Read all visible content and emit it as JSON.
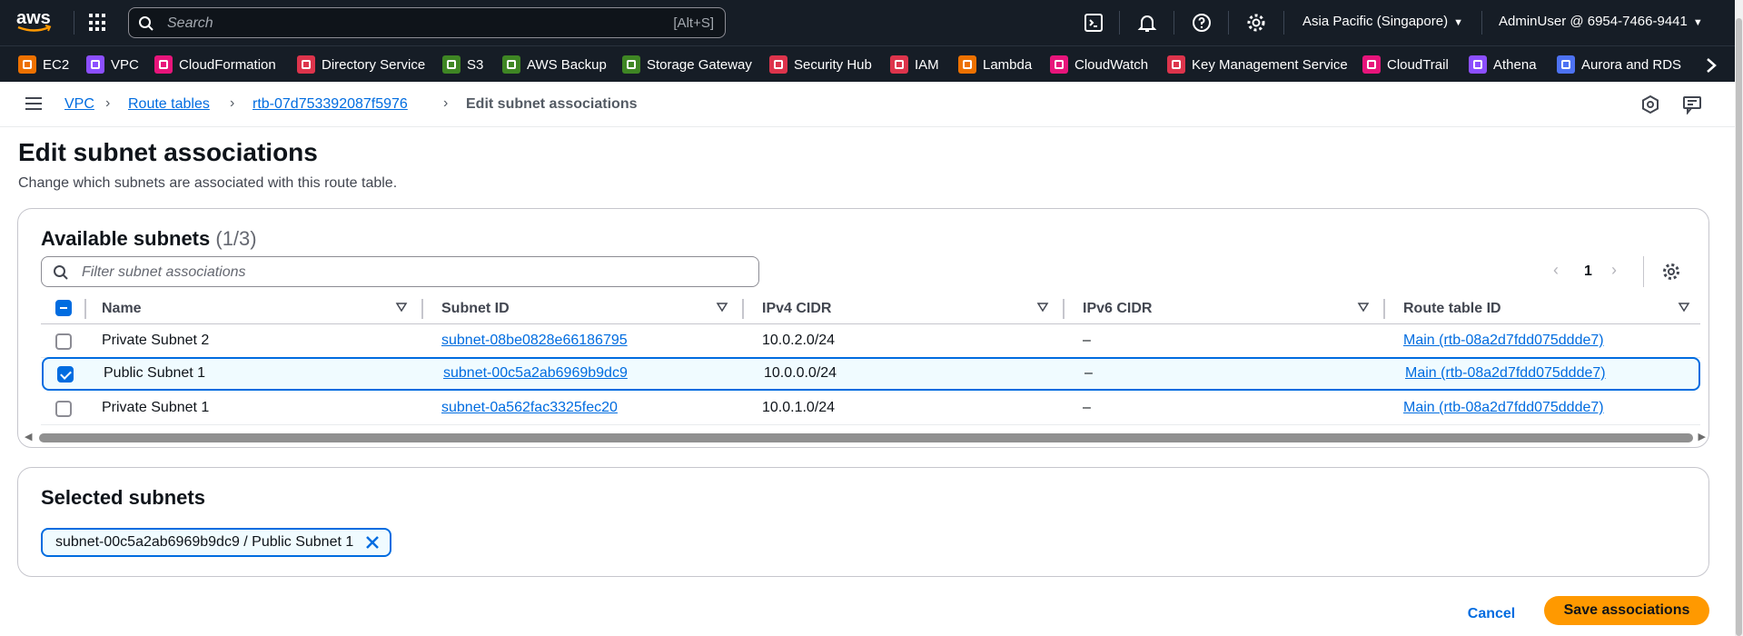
{
  "topnav": {
    "logo_text": "aws",
    "search_placeholder": "Search",
    "search_shortcut": "[Alt+S]",
    "region": "Asia Pacific (Singapore)",
    "account": "AdminUser @ 6954-7466-9441"
  },
  "favorites": [
    {
      "label": "EC2",
      "color": "#ed7100"
    },
    {
      "label": "VPC",
      "color": "#8c4fff"
    },
    {
      "label": "CloudFormation",
      "color": "#e7157b"
    },
    {
      "label": "Directory Service",
      "color": "#dd344c"
    },
    {
      "label": "S3",
      "color": "#3f8624"
    },
    {
      "label": "AWS Backup",
      "color": "#3f8624"
    },
    {
      "label": "Storage Gateway",
      "color": "#3f8624"
    },
    {
      "label": "Security Hub",
      "color": "#dd344c"
    },
    {
      "label": "IAM",
      "color": "#dd344c"
    },
    {
      "label": "Lambda",
      "color": "#ed7100"
    },
    {
      "label": "CloudWatch",
      "color": "#e7157b"
    },
    {
      "label": "Key Management Service",
      "color": "#dd344c"
    },
    {
      "label": "CloudTrail",
      "color": "#e7157b"
    },
    {
      "label": "Athena",
      "color": "#8c4fff"
    },
    {
      "label": "Aurora and RDS",
      "color": "#4d72f3"
    }
  ],
  "breadcrumb": {
    "items": [
      "VPC",
      "Route tables",
      "rtb-07d753392087f5976"
    ],
    "current": "Edit subnet associations"
  },
  "page": {
    "title": "Edit subnet associations",
    "description": "Change which subnets are associated with this route table."
  },
  "available": {
    "title": "Available subnets",
    "count": "(1/3)",
    "filter_placeholder": "Filter subnet associations",
    "page_number": "1",
    "columns": [
      "Name",
      "Subnet ID",
      "IPv4 CIDR",
      "IPv6 CIDR",
      "Route table ID"
    ],
    "rows": [
      {
        "name": "Private Subnet 2",
        "subnet_id": "subnet-08be0828e66186795",
        "ipv4": "10.0.2.0/24",
        "ipv6": "–",
        "route_table": "Main (rtb-08a2d7fdd075ddde7)",
        "selected": false
      },
      {
        "name": "Public Subnet 1",
        "subnet_id": "subnet-00c5a2ab6969b9dc9",
        "ipv4": "10.0.0.0/24",
        "ipv6": "–",
        "route_table": "Main (rtb-08a2d7fdd075ddde7)",
        "selected": true
      },
      {
        "name": "Private Subnet 1",
        "subnet_id": "subnet-0a562fac3325fec20",
        "ipv4": "10.0.1.0/24",
        "ipv6": "–",
        "route_table": "Main (rtb-08a2d7fdd075ddde7)",
        "selected": false
      }
    ]
  },
  "selected": {
    "title": "Selected subnets",
    "token": "subnet-00c5a2ab6969b9dc9 / Public Subnet 1"
  },
  "actions": {
    "cancel": "Cancel",
    "save": "Save associations"
  },
  "colors": {
    "nav_bg": "#161d26",
    "link": "#006ce0",
    "primary_button": "#ff9900",
    "selected_row_bg": "#f0fbff"
  }
}
